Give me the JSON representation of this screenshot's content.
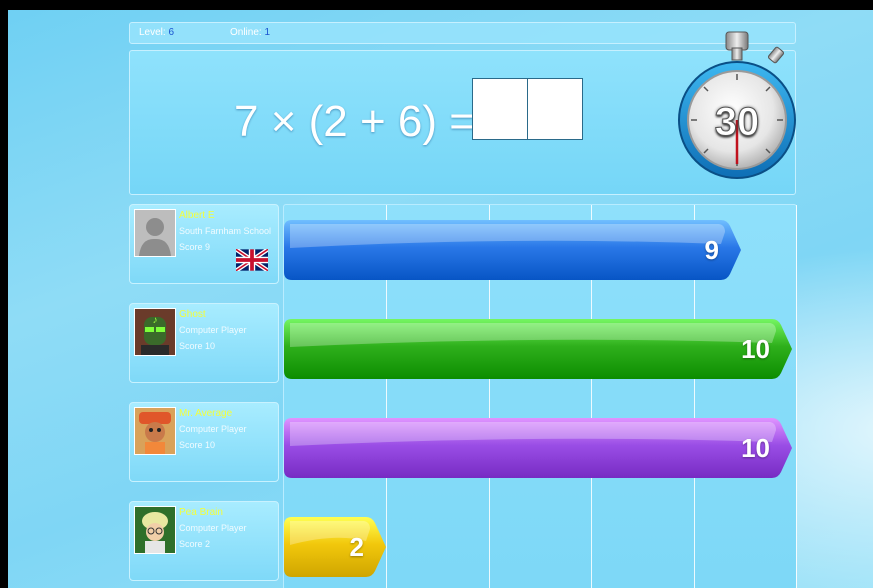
{
  "status": {
    "level_label": "Level:",
    "level_value": "6",
    "online_label": "Online:",
    "online_value": "1"
  },
  "question": {
    "expression": "7 × (2 + 6) =",
    "answer_digits": [
      "",
      ""
    ]
  },
  "timer": {
    "seconds": "30"
  },
  "players": [
    {
      "name": "Albert E",
      "line1": "South Farnham School",
      "score_text": "Score 9",
      "bar_value": 9,
      "bar_color": "#2a78e8",
      "flag": "uk-flag-icon",
      "avatar": "default-avatar-icon"
    },
    {
      "name": "Ghost",
      "line1": "Computer Player",
      "score_text": "Score 10",
      "bar_value": 10,
      "bar_color": "#2fb01c",
      "avatar": "ghost-avatar-icon"
    },
    {
      "name": "Mr. Average",
      "line1": "Computer Player",
      "score_text": "Score 10",
      "bar_value": 10,
      "bar_color": "#9a4ee6",
      "avatar": "mr-average-avatar-icon"
    },
    {
      "name": "Pea Brain",
      "line1": "Computer Player",
      "score_text": "Score 2",
      "bar_value": 2,
      "bar_color": "#f2c80c",
      "avatar": "pea-brain-avatar-icon"
    }
  ],
  "track": {
    "max_value": 10,
    "gridlines": 5
  }
}
